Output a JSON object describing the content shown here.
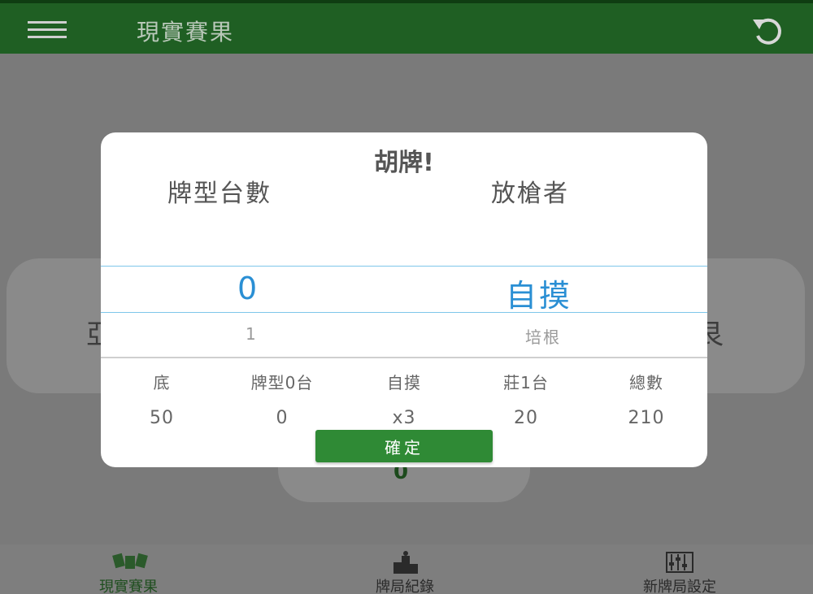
{
  "app_bar": {
    "title": "現實賽果"
  },
  "background": {
    "left_card_text": "亞",
    "right_card_text": "艮",
    "bottom_card_value": "0"
  },
  "dialog": {
    "title": "胡牌!",
    "col_fan_label": "牌型台數",
    "col_discarder_label": "放槍者",
    "fan_selected": "0",
    "fan_next": "1",
    "discarder_selected": "自摸",
    "discarder_next": "培根",
    "stats": [
      {
        "label": "底",
        "value": "50"
      },
      {
        "label": "牌型0台",
        "value": "0"
      },
      {
        "label": "自摸",
        "value": "x3"
      },
      {
        "label": "莊1台",
        "value": "20"
      },
      {
        "label": "總數",
        "value": "210"
      }
    ],
    "confirm_label": "確定"
  },
  "bottom_nav": [
    {
      "label": "現實賽果",
      "icon": "mahjong-tiles-icon",
      "active": true
    },
    {
      "label": "牌局紀錄",
      "icon": "podium-icon",
      "active": false
    },
    {
      "label": "新牌局設定",
      "icon": "sliders-icon",
      "active": false
    }
  ],
  "colors": {
    "app_bar": "#1f5f23",
    "accent_blue": "#2a8fd4",
    "button_green": "#2f8a35"
  }
}
